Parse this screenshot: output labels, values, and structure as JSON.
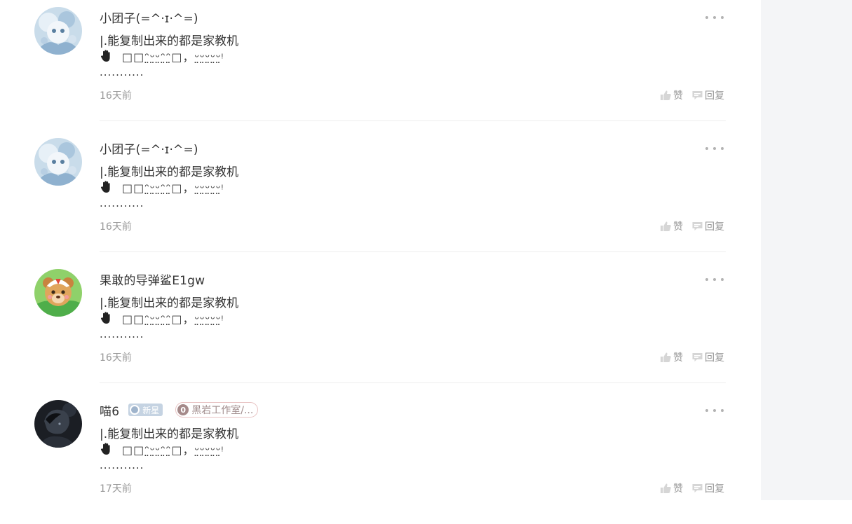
{
  "comments": [
    {
      "username": "小团子(=^·ɪ·^=)",
      "content_line1": "|.能复制出来的都是家教机",
      "content_line2": "□□ᵔ̤ᵕ̤ᵕ̤ᵔ̤ᵔ̤□，ᵕ̤ᵕ̤ᵕ̤ᵕ̤ᵕ̤ᵎ",
      "content_line3": "...........",
      "time": "16天前",
      "like_label": "赞",
      "reply_label": "回复",
      "avatar_icon": "anime-girl-avatar"
    },
    {
      "username": "小团子(=^·ɪ·^=)",
      "content_line1": "|.能复制出来的都是家教机",
      "content_line2": "□□ᵔ̤ᵕ̤ᵕ̤ᵔ̤ᵔ̤□，ᵕ̤ᵕ̤ᵕ̤ᵕ̤ᵕ̤ᵎ",
      "content_line3": "...........",
      "time": "16天前",
      "like_label": "赞",
      "reply_label": "回复",
      "avatar_icon": "anime-girl-avatar"
    },
    {
      "username": "果敢的导弹鲨E1gw",
      "content_line1": "|.能复制出来的都是家教机",
      "content_line2": "□□ᵔ̤ᵕ̤ᵕ̤ᵔ̤ᵔ̤□，ᵕ̤ᵕ̤ᵕ̤ᵕ̤ᵕ̤ᵎ",
      "content_line3": "...........",
      "time": "16天前",
      "like_label": "赞",
      "reply_label": "回复",
      "avatar_icon": "cartoon-bear-avatar"
    },
    {
      "username": "喵6",
      "badge_new": "新星",
      "badge_group_level": "0",
      "badge_group": "黑岩工作室/...",
      "content_line1": "|.能复制出来的都是家教机",
      "content_line2": "□□ᵔ̤ᵕ̤ᵕ̤ᵔ̤ᵔ̤□，ᵕ̤ᵕ̤ᵕ̤ᵕ̤ᵕ̤ᵎ",
      "content_line3": "...........",
      "time": "17天前",
      "like_label": "赞",
      "reply_label": "回复",
      "avatar_icon": "dark-portrait-avatar"
    }
  ],
  "colors": {
    "text": "#333333",
    "muted": "#999999",
    "divider": "#eeeeee",
    "side_panel": "#f4f5f7"
  }
}
